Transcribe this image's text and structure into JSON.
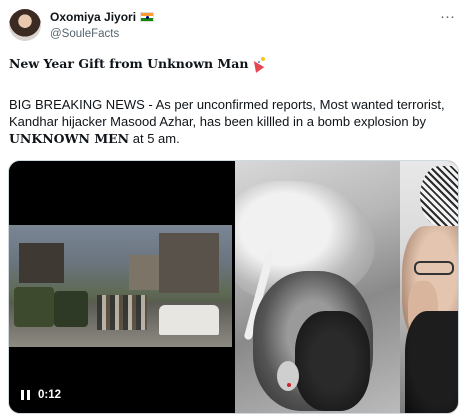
{
  "author": {
    "display_name": "Oxomiya Jiyori",
    "handle": "@SouleFacts",
    "flag_icon": "india-flag-icon"
  },
  "more_menu": "···",
  "headline": {
    "text": "New Year Gift from Unknown Man",
    "emoji_icon": "party-popper-icon"
  },
  "body": {
    "part1": "BIG BREAKING NEWS - As per unconfirmed reports, Most wanted terrorist, Kandhar hijacker Masood Azhar, has been killled in a bomb explosion by ",
    "bold": "UNKNOWN MEN",
    "part2": " at 5 am."
  },
  "video": {
    "timecode": "0:12",
    "state": "playing"
  },
  "colors": {
    "text_primary": "#0f1419",
    "text_secondary": "#536471",
    "border": "#cfd9de"
  }
}
